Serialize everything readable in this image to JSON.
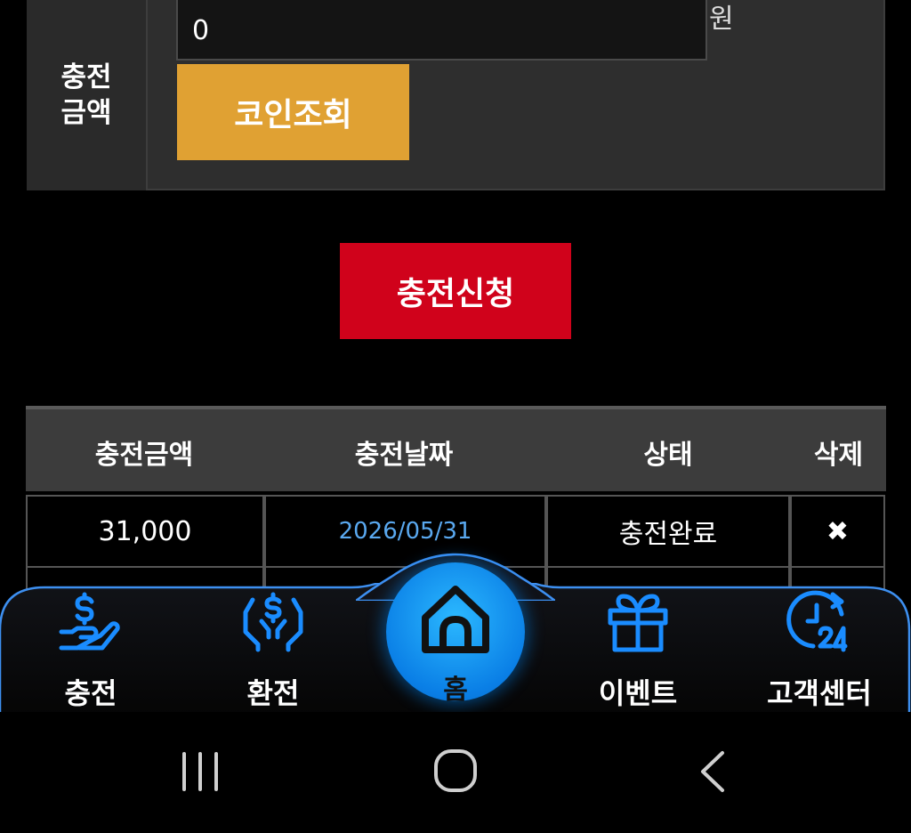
{
  "charge_form": {
    "label_line1": "충전",
    "label_line2": "금액",
    "amount_value": "0",
    "currency_unit": "원",
    "coin_check_label": "코인조회"
  },
  "apply_button_label": "충전신청",
  "history_table": {
    "headers": [
      "충전금액",
      "충전날짜",
      "상태",
      "삭제"
    ],
    "rows": [
      {
        "amount": "31,000",
        "date": "2026/05/31",
        "status": "충전완료",
        "delete_icon": "✖"
      }
    ]
  },
  "bottom_nav": {
    "items": [
      {
        "label": "충전",
        "icon": "hand-dollar-icon"
      },
      {
        "label": "환전",
        "icon": "hands-dollar-icon"
      },
      {
        "label": "홈",
        "icon": "home-icon"
      },
      {
        "label": "이벤트",
        "icon": "gift-icon"
      },
      {
        "label": "고객센터",
        "icon": "clock-24-icon"
      }
    ]
  },
  "colors": {
    "accent_orange": "#e0a133",
    "accent_red": "#d0021b",
    "nav_blue": "#1a8cff",
    "date_link_blue": "#5aa9f0"
  }
}
